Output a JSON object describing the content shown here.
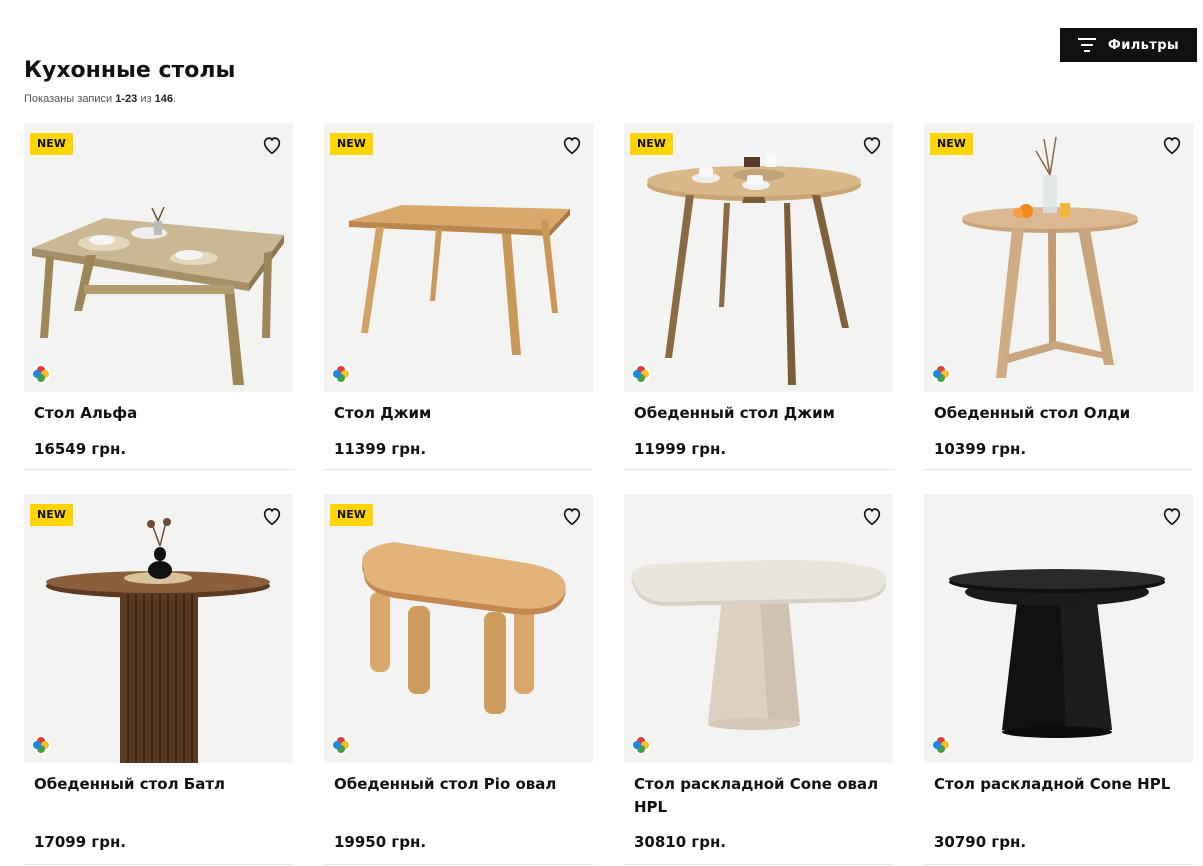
{
  "header": {
    "filters_label": "Фильтры",
    "title": "Кухонные столы",
    "records_prefix": "Показаны записи ",
    "records_range": "1-23",
    "records_mid": " из ",
    "records_total": "146",
    "records_suffix": "."
  },
  "colors": {
    "badge": "#ffd500",
    "button_bg": "#111111"
  },
  "products": [
    {
      "name": "Стол Альфа",
      "price": "16549 грн.",
      "badge": "NEW"
    },
    {
      "name": "Стол Джим",
      "price": "11399 грн.",
      "badge": "NEW"
    },
    {
      "name": "Обеденный стол Джим",
      "price": "11999 грн.",
      "badge": "NEW"
    },
    {
      "name": "Обеденный стол Олди",
      "price": "10399 грн.",
      "badge": "NEW"
    },
    {
      "name": "Обеденный стол Батл",
      "price": "17099 грн.",
      "badge": "NEW"
    },
    {
      "name": "Обеденный стол Pio овал",
      "price": "19950 грн.",
      "badge": "NEW"
    },
    {
      "name": "Стол раскладной Cone овал HPL",
      "price": "30810 грн.",
      "badge": ""
    },
    {
      "name": "Стол раскладной Cone HPL",
      "price": "30790 грн.",
      "badge": ""
    }
  ],
  "icons": {
    "filter": "filter-icon",
    "favorite": "heart-icon",
    "colors": "color-options-icon"
  }
}
